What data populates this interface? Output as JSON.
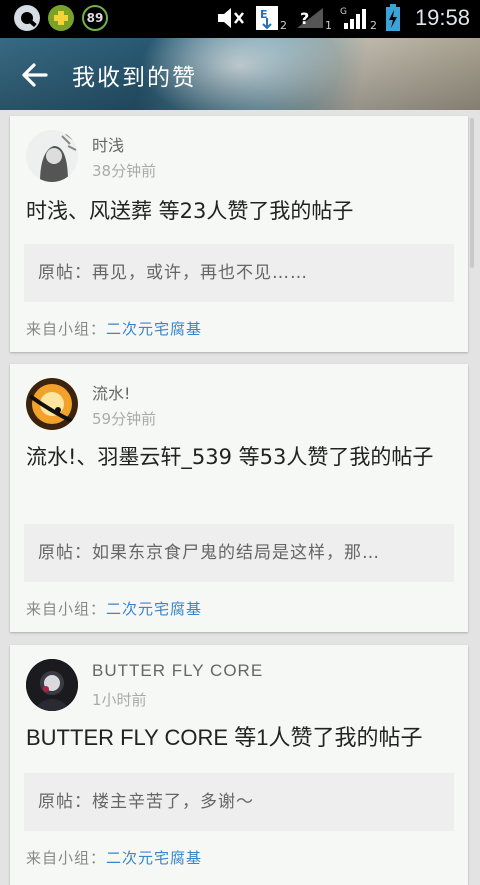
{
  "status_bar": {
    "badge": "89",
    "signal_label_1": "2",
    "signal_label_2": "1",
    "signal_label_3": "2",
    "clock": "19:58"
  },
  "header": {
    "title": "我收到的赞",
    "back_icon": "arrow-left-icon"
  },
  "cards": [
    {
      "user": "时浅",
      "time": "38分钟前",
      "text": "时浅、风送葬 等23人赞了我的帖子",
      "quote": "原帖：再见，或许，再也不见……",
      "from_label": "来自小组：",
      "group": "二次元宅腐基"
    },
    {
      "user": "流水!",
      "time": "59分钟前",
      "text": "流水!、羽墨云轩_539 等53人赞了我的帖子",
      "quote": "原帖：如果东京食尸鬼的结局是这样，那…",
      "from_label": "来自小组：",
      "group": "二次元宅腐基"
    },
    {
      "user": "BUTTER FLY  CORE",
      "time": "1小时前",
      "text": "BUTTER FLY  CORE 等1人赞了我的帖子",
      "quote": "原帖：楼主辛苦了，多谢～",
      "from_label": "来自小组：",
      "group": "二次元宅腐基"
    }
  ]
}
